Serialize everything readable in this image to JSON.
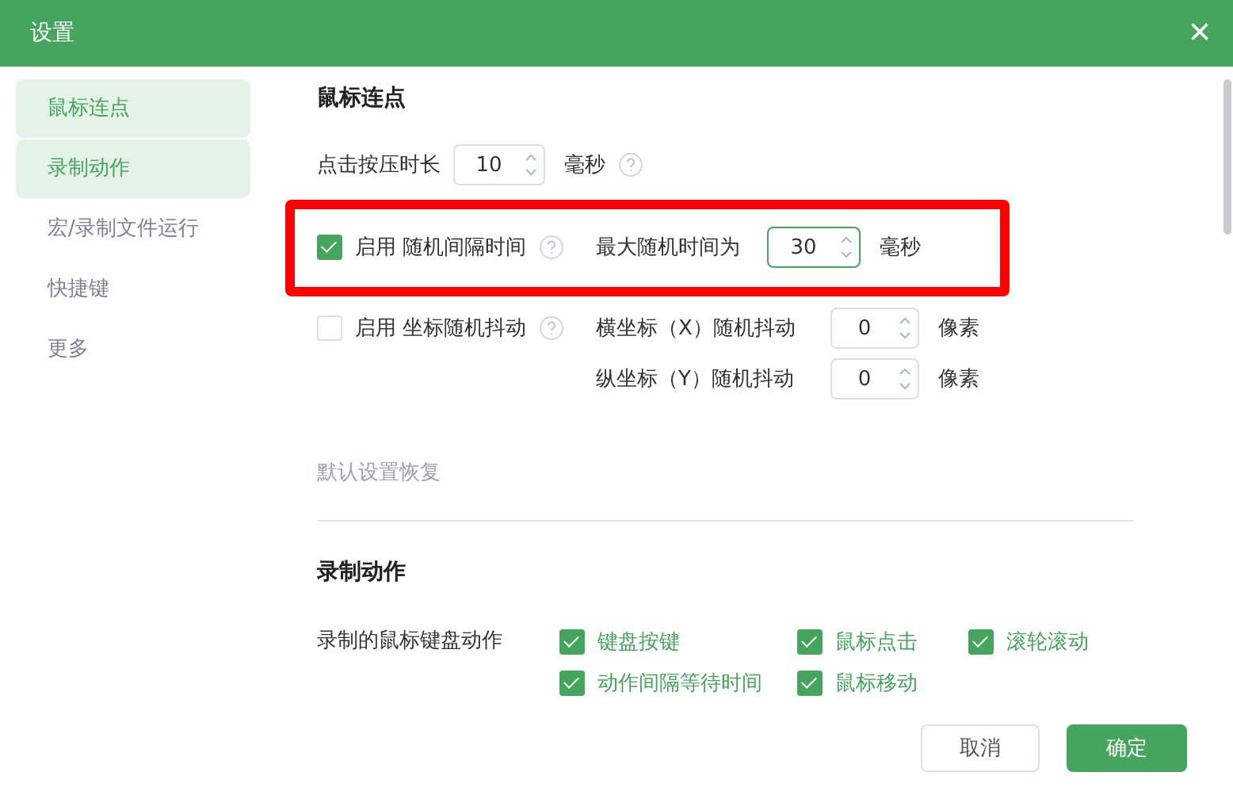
{
  "window": {
    "title": "设置",
    "close": "×"
  },
  "sidebar": {
    "items": [
      {
        "label": "鼠标连点",
        "selected": true
      },
      {
        "label": "录制动作",
        "selected": true
      },
      {
        "label": "宏/录制文件运行",
        "selected": false
      },
      {
        "label": "快捷键",
        "selected": false
      },
      {
        "label": "更多",
        "selected": false
      }
    ]
  },
  "sections": [
    {
      "heading": "鼠标连点",
      "rows": [
        {
          "kind": "field",
          "label": "点击按压时长",
          "value": "10",
          "unit": "毫秒",
          "help": true,
          "focused": false
        },
        {
          "kind": "toggle",
          "checked": true,
          "label": "启用 随机间隔时间",
          "help": true,
          "highlighted": true,
          "fields": [
            {
              "label": "最大随机时间为",
              "value": "30",
              "unit": "毫秒",
              "focused": true
            }
          ]
        },
        {
          "kind": "toggle",
          "checked": false,
          "label": "启用 坐标随机抖动",
          "help": true,
          "highlighted": false,
          "fields": [
            {
              "label": "横坐标（X）随机抖动",
              "value": "0",
              "unit": "像素",
              "focused": false
            },
            {
              "label": "纵坐标（Y）随机抖动",
              "value": "0",
              "unit": "像素",
              "focused": false
            }
          ]
        }
      ],
      "reset_link": "默认设置恢复"
    },
    {
      "heading": "录制动作",
      "group_label": "录制的鼠标键盘动作",
      "options": [
        {
          "label": "键盘按键",
          "checked": true
        },
        {
          "label": "鼠标点击",
          "checked": true
        },
        {
          "label": "滚轮滚动",
          "checked": true
        },
        {
          "label": "动作间隔等待时间",
          "checked": true
        },
        {
          "label": "鼠标移动",
          "checked": true
        }
      ]
    }
  ],
  "buttons": [
    {
      "label": "取消",
      "kind": "secondary"
    },
    {
      "label": "确定",
      "kind": "primary"
    }
  ]
}
